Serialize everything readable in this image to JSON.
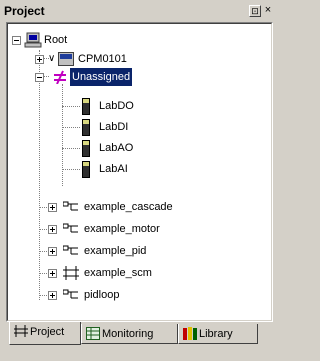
{
  "title": "Project",
  "title_buttons": {
    "pin_glyph": "⊡",
    "close_glyph": "×"
  },
  "tree": {
    "root_label": "Root",
    "cpm_label": "CPM0101",
    "unassigned_label": "Unassigned",
    "io_items": [
      "LabDO",
      "LabDI",
      "LabAO",
      "LabAI"
    ],
    "program_items": [
      "example_cascade",
      "example_motor",
      "example_pid",
      "example_scm",
      "pidloop"
    ]
  },
  "tabs": [
    "Project",
    "Monitoring",
    "Library"
  ],
  "colors": {
    "selection": "#0a246a",
    "panel": "#d4d0c8"
  }
}
